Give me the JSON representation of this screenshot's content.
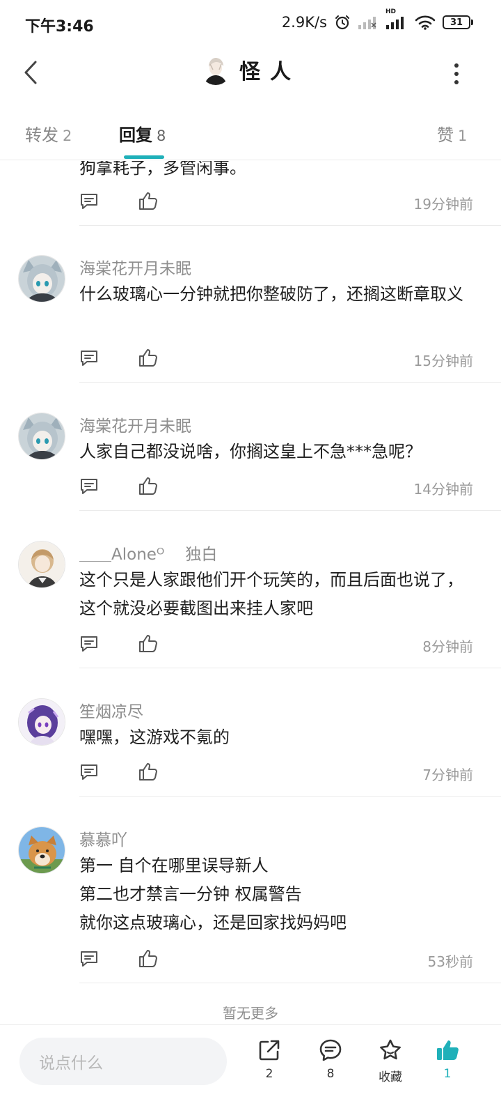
{
  "status_bar": {
    "time": "下午3:46",
    "net_speed": "2.9K/s",
    "hd_label": "HD",
    "battery": "31"
  },
  "nav": {
    "title": "怪人"
  },
  "tabs": [
    {
      "label": "转发",
      "count": "2"
    },
    {
      "label": "回复",
      "count": "8"
    },
    {
      "label": "赞",
      "count": "1"
    }
  ],
  "active_tab": "回复",
  "comments": [
    {
      "username": "",
      "text": "狗拿耗子，多管闲事。",
      "time": "19分钟前",
      "avatar": "none"
    },
    {
      "username": "海棠花开月未眠",
      "text": "什么玻璃心一分钟就把你整破防了，还搁这断章取义",
      "time": "15分钟前",
      "avatar": "anime-girl-cat-ears"
    },
    {
      "username": "海棠花开月未眠",
      "text": "人家自己都没说啥，你搁这皇上不急***急呢？",
      "time": "14分钟前",
      "avatar": "anime-girl-cat-ears"
    },
    {
      "username": "＿＿Aloneᴼ",
      "tag": "独白",
      "text": "这个只是人家跟他们开个玩笑的，而且后面也说了，这个就没必要截图出来挂人家吧",
      "time": "8分钟前",
      "avatar": "anime-boy-light"
    },
    {
      "username": "笙烟凉尽",
      "text": "嘿嘿，这游戏不氪的",
      "time": "7分钟前",
      "avatar": "anime-girl-purple"
    },
    {
      "username": "慕慕吖",
      "text": "第一  自个在哪里误导新人\n第二也才禁言一分钟   权属警告\n就你这点玻璃心，还是回家找妈妈吧",
      "time": "53秒前",
      "avatar": "shiba-dog"
    }
  ],
  "no_more": "暂无更多",
  "bottom_bar": {
    "input_placeholder": "说点什么",
    "share_count": "2",
    "comment_count": "8",
    "favorite_label": "收藏",
    "like_count": "1"
  },
  "colors": {
    "accent": "#1fb0b9",
    "muted_text": "#8e8e8e",
    "divider": "#ebebeb"
  }
}
